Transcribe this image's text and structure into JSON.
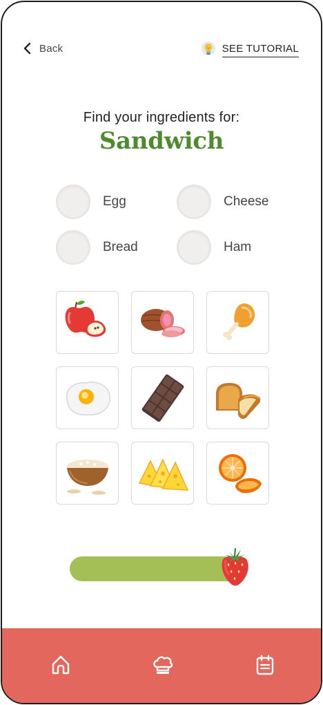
{
  "header": {
    "back_label": "Back",
    "tutorial_label": "SEE TUTORIAL"
  },
  "heading": {
    "subtitle": "Find your ingredients for:",
    "title": "Sandwich"
  },
  "ingredients": [
    {
      "label": "Egg",
      "checked": false
    },
    {
      "label": "Cheese",
      "checked": false
    },
    {
      "label": "Bread",
      "checked": false
    },
    {
      "label": "Ham",
      "checked": false
    }
  ],
  "food_tiles": [
    "apple",
    "ham",
    "chicken-leg",
    "fried-egg",
    "chocolate",
    "bread",
    "rice",
    "cheese",
    "orange"
  ],
  "progress": {
    "fraction": 0.95
  },
  "bottom_nav": [
    "home-icon",
    "chef-hat-icon",
    "calendar-icon"
  ],
  "colors": {
    "accent_green": "#4f8a2e",
    "progress_green": "#a3bf56",
    "nav_red": "#e3675d"
  }
}
